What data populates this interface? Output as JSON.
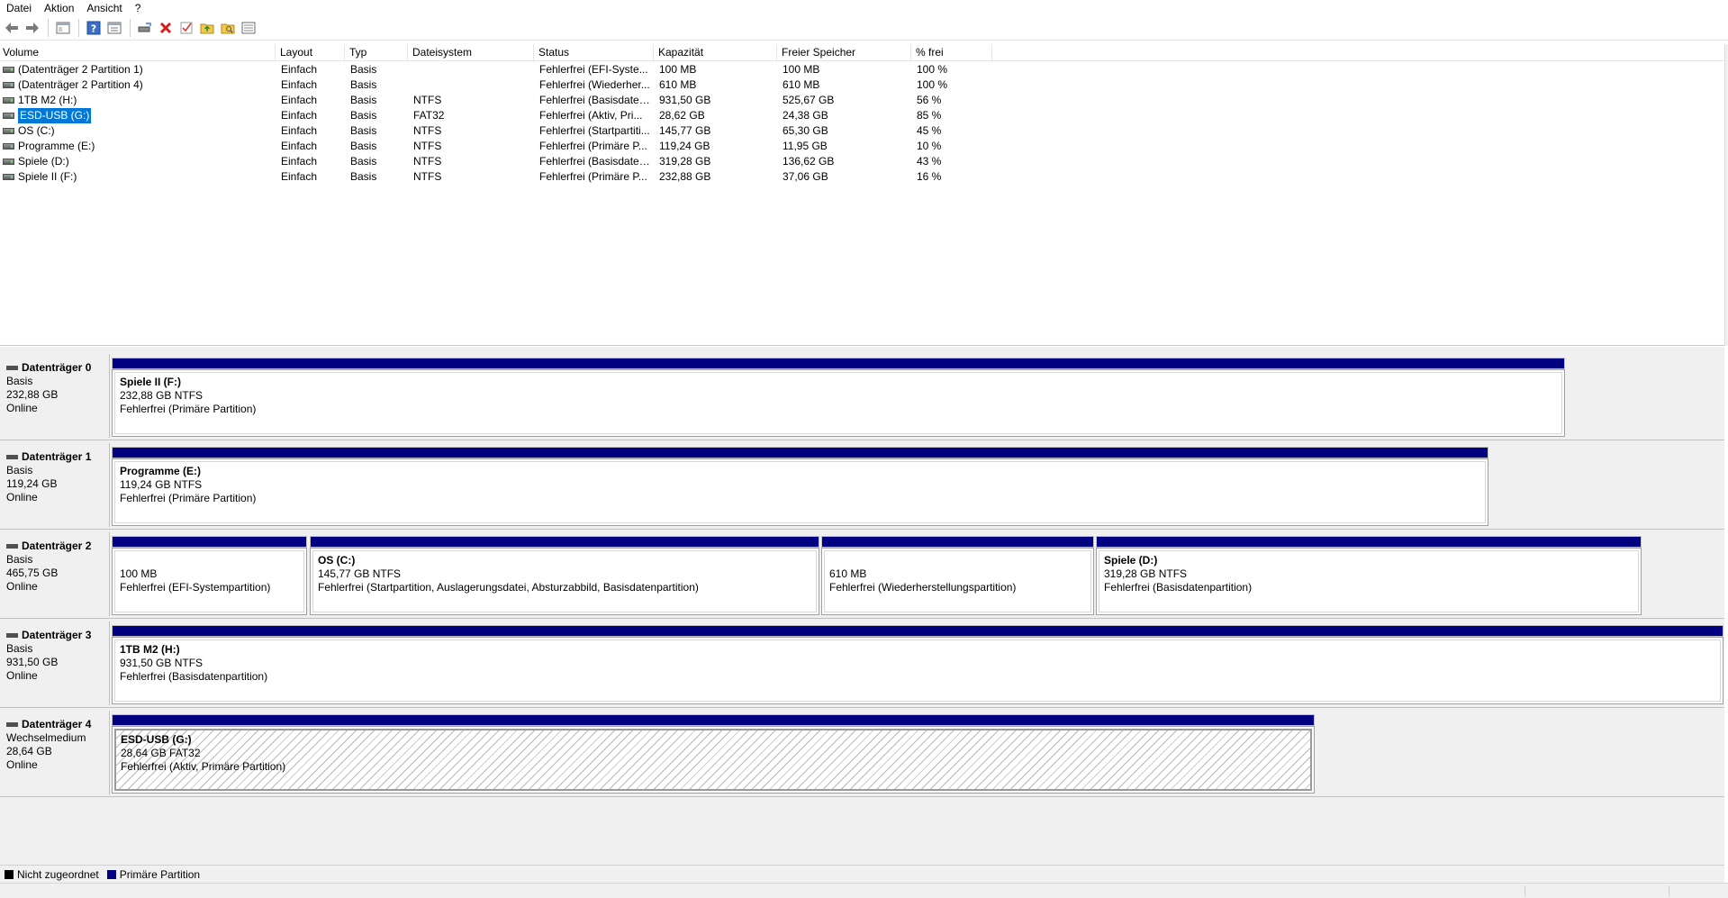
{
  "menu": [
    "Datei",
    "Aktion",
    "Ansicht",
    "?"
  ],
  "toolbar": [
    "back-icon",
    "forward-icon",
    "console-tree-icon",
    "help-icon",
    "properties-icon",
    "connect-drive-icon",
    "delete-icon",
    "check-icon",
    "folder-up-icon",
    "folder-search-icon",
    "list-view-icon"
  ],
  "columns": {
    "volume": "Volume",
    "layout": "Layout",
    "type": "Typ",
    "filesystem": "Dateisystem",
    "status": "Status",
    "capacity": "Kapazität",
    "free": "Freier Speicher",
    "pct": "% frei"
  },
  "volumes": [
    {
      "volume": "(Datenträger 2 Partition 1)",
      "layout": "Einfach",
      "type": "Basis",
      "fs": "",
      "status": "Fehlerfrei (EFI-Syste...",
      "capacity": "100 MB",
      "free": "100 MB",
      "pct": "100 %"
    },
    {
      "volume": "(Datenträger 2 Partition 4)",
      "layout": "Einfach",
      "type": "Basis",
      "fs": "",
      "status": "Fehlerfrei (Wiederher...",
      "capacity": "610 MB",
      "free": "610 MB",
      "pct": "100 %"
    },
    {
      "volume": "1TB M2 (H:)",
      "layout": "Einfach",
      "type": "Basis",
      "fs": "NTFS",
      "status": "Fehlerfrei (Basisdaten...",
      "capacity": "931,50 GB",
      "free": "525,67 GB",
      "pct": "56 %"
    },
    {
      "volume": "ESD-USB (G:)",
      "layout": "Einfach",
      "type": "Basis",
      "fs": "FAT32",
      "status": "Fehlerfrei (Aktiv, Pri...",
      "capacity": "28,62 GB",
      "free": "24,38 GB",
      "pct": "85 %",
      "selected": true
    },
    {
      "volume": "OS (C:)",
      "layout": "Einfach",
      "type": "Basis",
      "fs": "NTFS",
      "status": "Fehlerfrei (Startpartiti...",
      "capacity": "145,77 GB",
      "free": "65,30 GB",
      "pct": "45 %"
    },
    {
      "volume": "Programme (E:)",
      "layout": "Einfach",
      "type": "Basis",
      "fs": "NTFS",
      "status": "Fehlerfrei (Primäre P...",
      "capacity": "119,24 GB",
      "free": "11,95 GB",
      "pct": "10 %"
    },
    {
      "volume": "Spiele (D:)",
      "layout": "Einfach",
      "type": "Basis",
      "fs": "NTFS",
      "status": "Fehlerfrei (Basisdaten...",
      "capacity": "319,28 GB",
      "free": "136,62 GB",
      "pct": "43 %"
    },
    {
      "volume": "Spiele II (F:)",
      "layout": "Einfach",
      "type": "Basis",
      "fs": "NTFS",
      "status": "Fehlerfrei (Primäre P...",
      "capacity": "232,88 GB",
      "free": "37,06 GB",
      "pct": "16 %"
    }
  ],
  "disks": [
    {
      "name": "Datenträger 0",
      "type": "Basis",
      "size": "232,88 GB",
      "state": "Online",
      "partitions": [
        {
          "name": "Spiele II  (F:)",
          "size": "232,88 GB NTFS",
          "status": "Fehlerfrei (Primäre Partition)"
        }
      ]
    },
    {
      "name": "Datenträger 1",
      "type": "Basis",
      "size": "119,24 GB",
      "state": "Online",
      "partitions": [
        {
          "name": "Programme  (E:)",
          "size": "119,24 GB NTFS",
          "status": "Fehlerfrei (Primäre Partition)"
        }
      ]
    },
    {
      "name": "Datenträger 2",
      "type": "Basis",
      "size": "465,75 GB",
      "state": "Online",
      "partitions": [
        {
          "name": "",
          "size": "100 MB",
          "status": "Fehlerfrei (EFI-Systempartition)"
        },
        {
          "name": "OS  (C:)",
          "size": "145,77 GB NTFS",
          "status": "Fehlerfrei (Startpartition, Auslagerungsdatei, Absturzabbild, Basisdatenpartition)"
        },
        {
          "name": "",
          "size": "610 MB",
          "status": "Fehlerfrei (Wiederherstellungspartition)"
        },
        {
          "name": "Spiele  (D:)",
          "size": "319,28 GB NTFS",
          "status": "Fehlerfrei (Basisdatenpartition)"
        }
      ]
    },
    {
      "name": "Datenträger 3",
      "type": "Basis",
      "size": "931,50 GB",
      "state": "Online",
      "partitions": [
        {
          "name": "1TB M2  (H:)",
          "size": "931,50 GB NTFS",
          "status": "Fehlerfrei (Basisdatenpartition)"
        }
      ]
    },
    {
      "name": "Datenträger 4",
      "type": "Wechselmedium",
      "size": "28,64 GB",
      "state": "Online",
      "partitions": [
        {
          "name": "ESD-USB  (G:)",
          "size": "28,64 GB FAT32",
          "status": "Fehlerfrei (Aktiv, Primäre Partition)",
          "selected": true
        }
      ]
    }
  ],
  "legend": [
    {
      "label": "Nicht zugeordnet",
      "color": "#000000"
    },
    {
      "label": "Primäre Partition",
      "color": "#000080"
    }
  ]
}
